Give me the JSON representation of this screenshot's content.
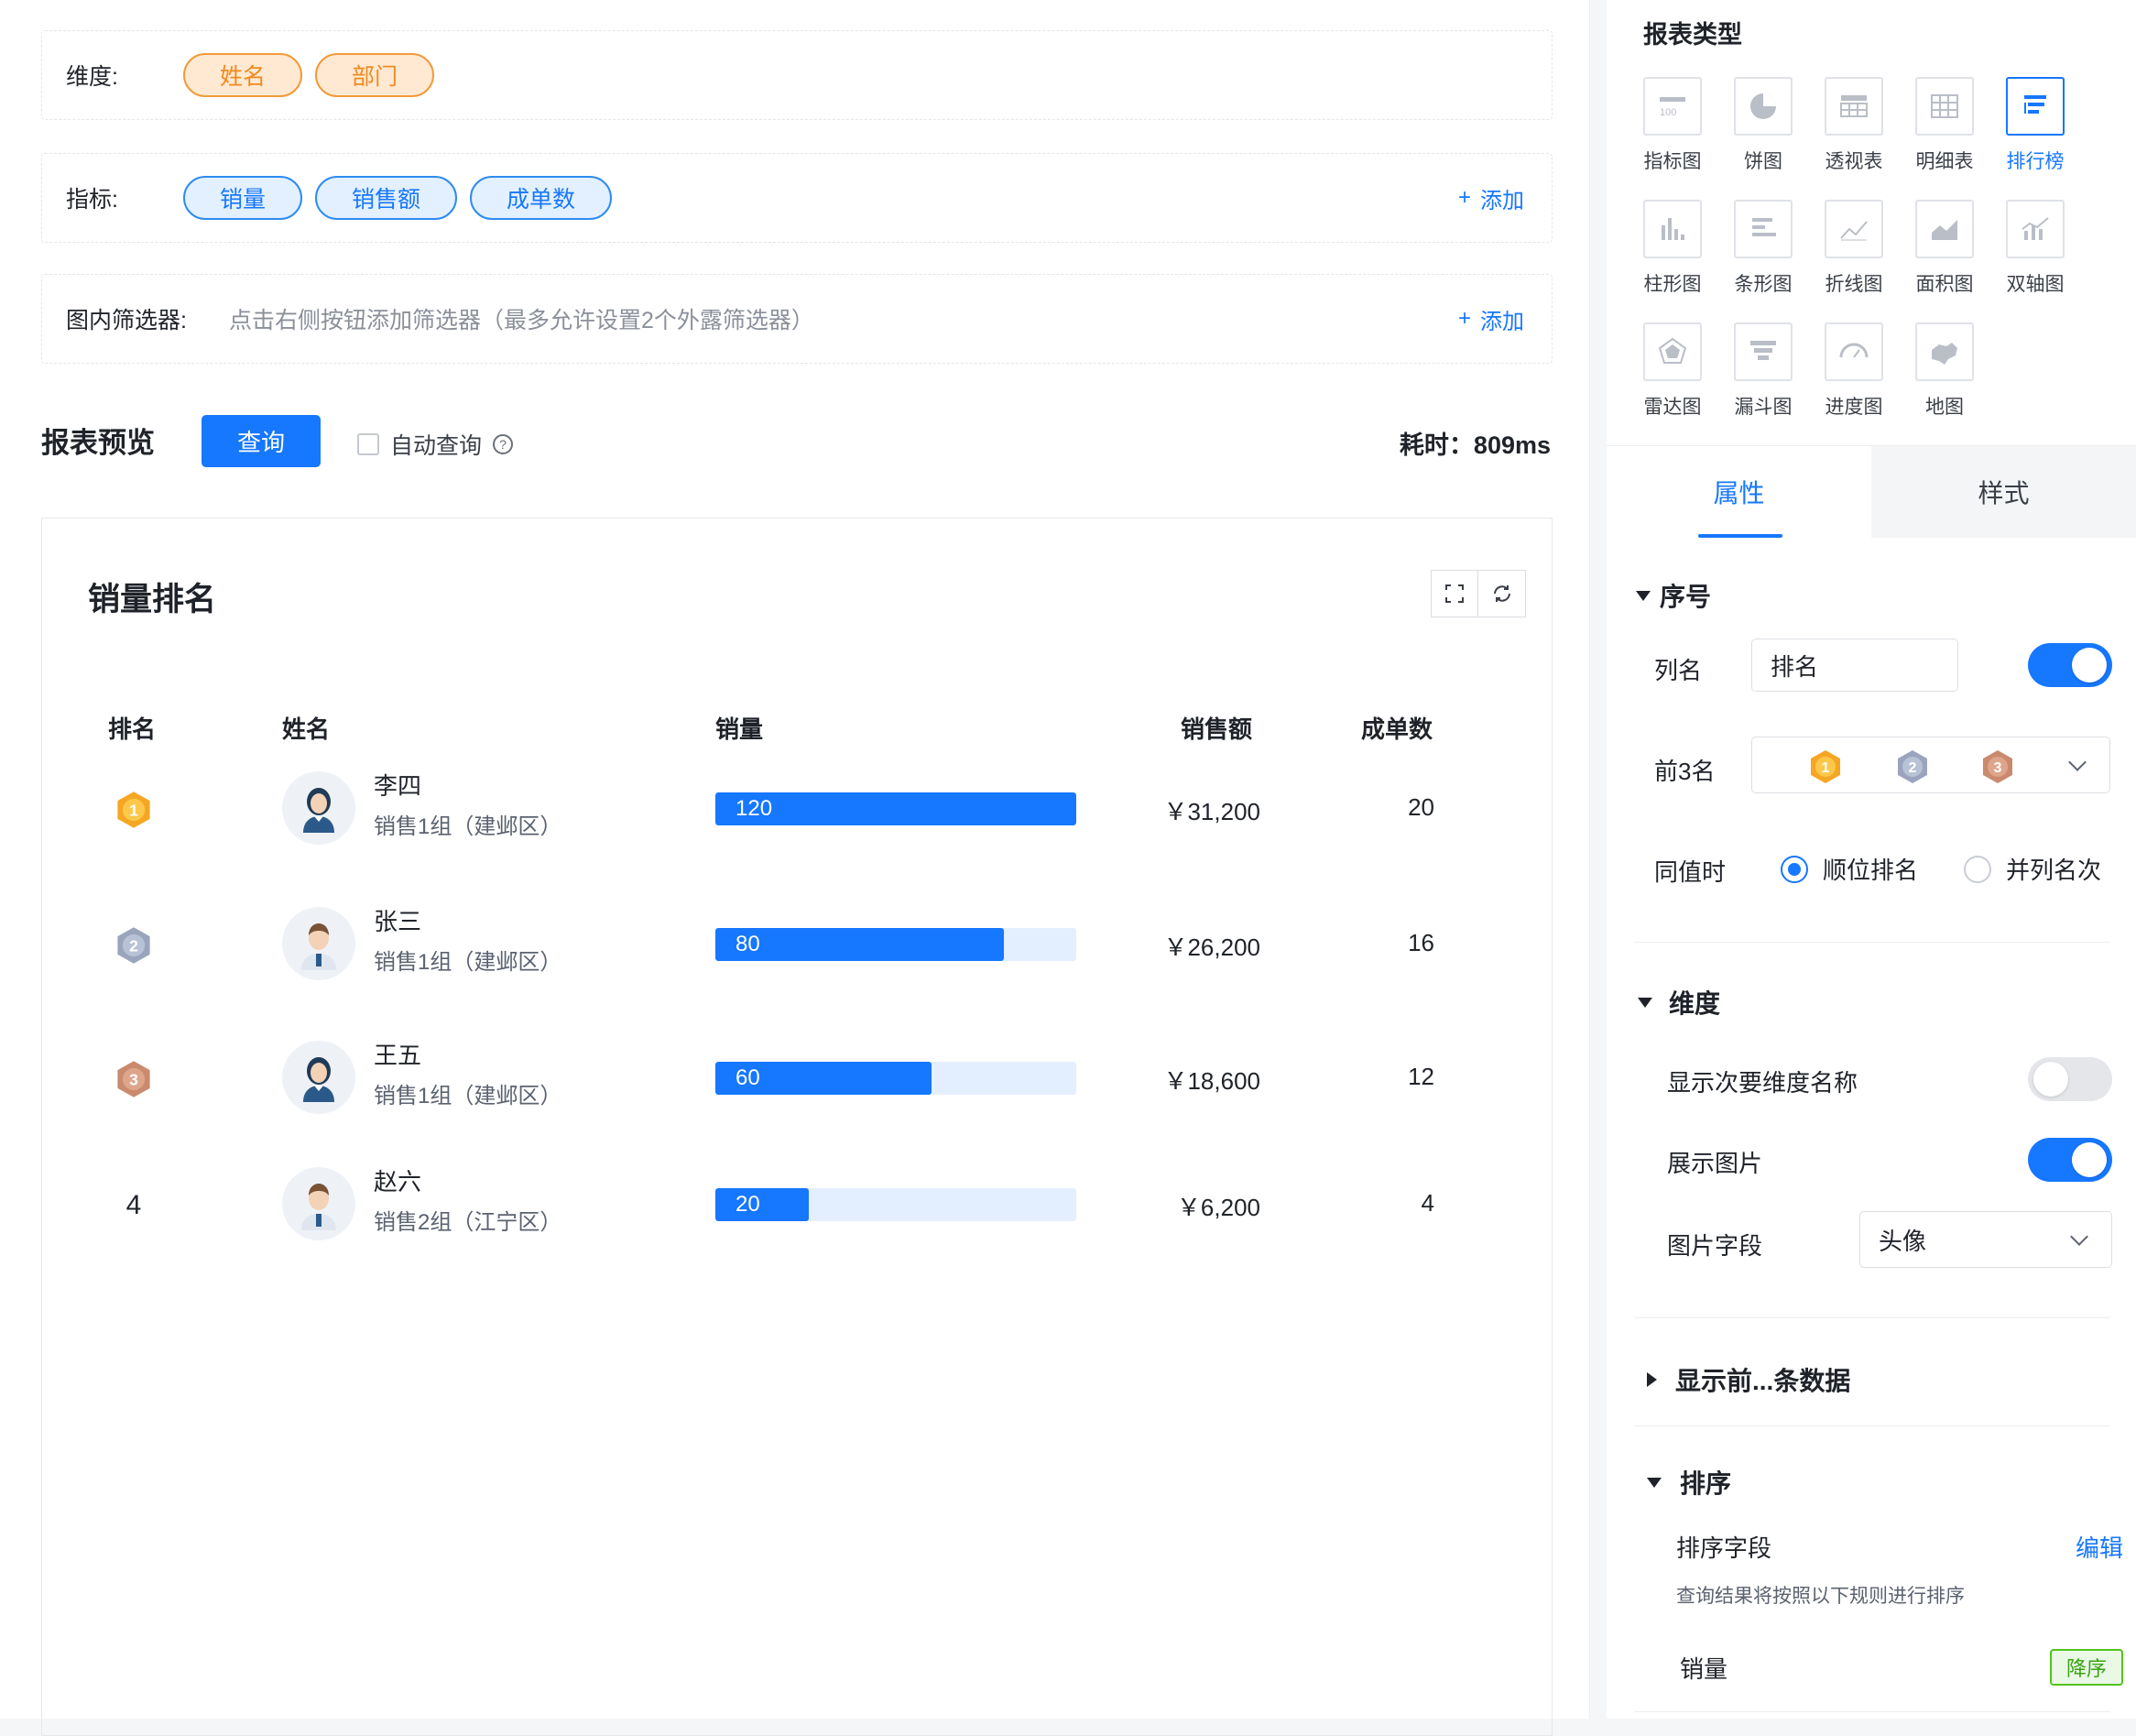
{
  "dimensions": {
    "label": "维度:",
    "pills": [
      "姓名",
      "部门"
    ]
  },
  "metrics": {
    "label": "指标:",
    "pills": [
      "销量",
      "销售额",
      "成单数"
    ],
    "add_label": "添加"
  },
  "filters": {
    "label": "图内筛选器:",
    "placeholder": "点击右侧按钮添加筛选器（最多允许设置2个外露筛选器）",
    "add_label": "添加"
  },
  "preview": {
    "title": "报表预览",
    "query_button": "查询",
    "auto_query_label": "自动查询",
    "elapsed": "耗时：809ms"
  },
  "report": {
    "title": "销量排名",
    "columns": [
      "排名",
      "姓名",
      "销量",
      "销售额",
      "成单数"
    ],
    "rows": [
      {
        "rank": "1",
        "name": "李四",
        "dept": "销售1组（建邺区）",
        "sales": "120",
        "sales_pct": 1.0,
        "amount": "￥31,200",
        "orders": "20",
        "avatar": "female-avatar-icon"
      },
      {
        "rank": "2",
        "name": "张三",
        "dept": "销售1组（建邺区）",
        "sales": "80",
        "sales_pct": 0.8,
        "amount": "￥26,200",
        "orders": "16",
        "avatar": "male-avatar-icon"
      },
      {
        "rank": "3",
        "name": "王五",
        "dept": "销售1组（建邺区）",
        "sales": "60",
        "sales_pct": 0.6,
        "amount": "￥18,600",
        "orders": "12",
        "avatar": "female-avatar-icon"
      },
      {
        "rank": "4",
        "name": "赵六",
        "dept": "销售2组（江宁区）",
        "sales": "20",
        "sales_pct": 0.26,
        "amount": "￥6,200",
        "orders": "4",
        "avatar": "male-avatar-icon"
      }
    ]
  },
  "panel": {
    "report_type_title": "报表类型",
    "types": [
      "指标图",
      "饼图",
      "透视表",
      "明细表",
      "排行榜",
      "柱形图",
      "条形图",
      "折线图",
      "面积图",
      "双轴图",
      "雷达图",
      "漏斗图",
      "进度图",
      "地图"
    ],
    "active_type": "排行榜",
    "tabs": [
      "属性",
      "样式"
    ],
    "active_tab": "属性",
    "serial": {
      "title": "序号",
      "col_name_label": "列名",
      "col_name_value": "排名",
      "top3_label": "前3名",
      "tie_label": "同值时",
      "tie_options": [
        "顺位排名",
        "并列名次"
      ],
      "tie_selected": "顺位排名"
    },
    "dimension": {
      "title": "维度",
      "show_secondary_label": "显示次要维度名称",
      "show_image_label": "展示图片",
      "image_field_label": "图片字段",
      "image_field_value": "头像"
    },
    "top_n": {
      "title": "显示前...条数据"
    },
    "sort": {
      "title": "排序",
      "field_label": "排序字段",
      "edit_label": "编辑",
      "desc": "查询结果将按照以下规则进行排序",
      "rule_field": "销量",
      "rule_order": "降序"
    }
  },
  "colors": {
    "accent": "#1677ff",
    "orange": "#f08a1f",
    "gold": "#f5a623",
    "silver": "#9aa5bd",
    "bronze": "#c98a6e"
  }
}
